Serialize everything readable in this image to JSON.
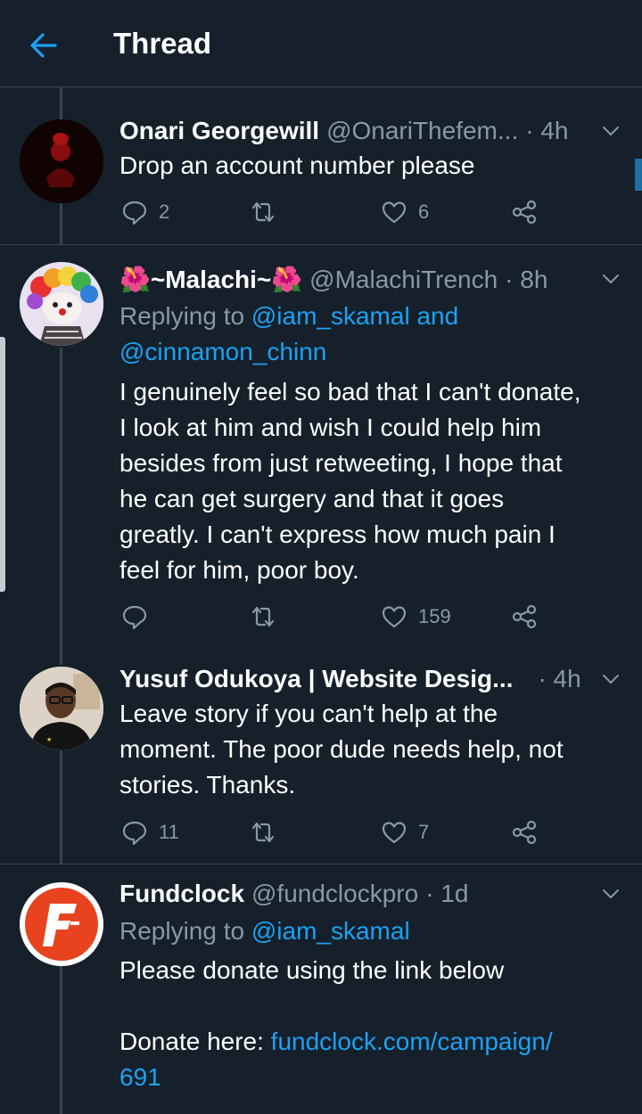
{
  "header": {
    "title": "Thread",
    "back_icon": "arrow-left-icon",
    "accent": "#1da1f2"
  },
  "tweets": [
    {
      "name": "Onari Georgewill",
      "handle": "@OnariThefem...",
      "time": "· 4h",
      "text": "Drop an account number please",
      "replies": "2",
      "retweets": "",
      "likes": "6"
    },
    {
      "name": "~Malachi~",
      "name_emoji": "🌺",
      "handle": "@MalachiTrench",
      "time": "· 8h",
      "replying_prefix": "Replying to",
      "replying_users": "@iam_skamal and",
      "replying_users_2": "@cinnamon_chinn",
      "text_lines": [
        "I genuinely feel so bad that I can't donate,",
        "I look at him and wish I could help him",
        "besides from just retweeting, I hope that",
        "he can get surgery and that it goes",
        "greatly. I can't express how much pain I",
        "feel for him, poor boy."
      ],
      "replies": "",
      "retweets": "",
      "likes": "159"
    },
    {
      "name": "Yusuf Odukoya | Website Desig...",
      "handle": "",
      "time": "· 4h",
      "text_lines": [
        "Leave story if you can't help at the",
        "moment. The poor dude needs help, not",
        "stories. Thanks."
      ],
      "replies": "11",
      "retweets": "",
      "likes": "7"
    },
    {
      "name": "Fundclock",
      "handle": "@fundclockpro",
      "time": "· 1d",
      "replying_prefix": "Replying to",
      "replying_users": "@iam_skamal",
      "text": "Please donate using the link below",
      "donate_prefix": "Donate here:",
      "donate_link": "fundclock.com/campaign/",
      "donate_link_2": "691"
    }
  ]
}
